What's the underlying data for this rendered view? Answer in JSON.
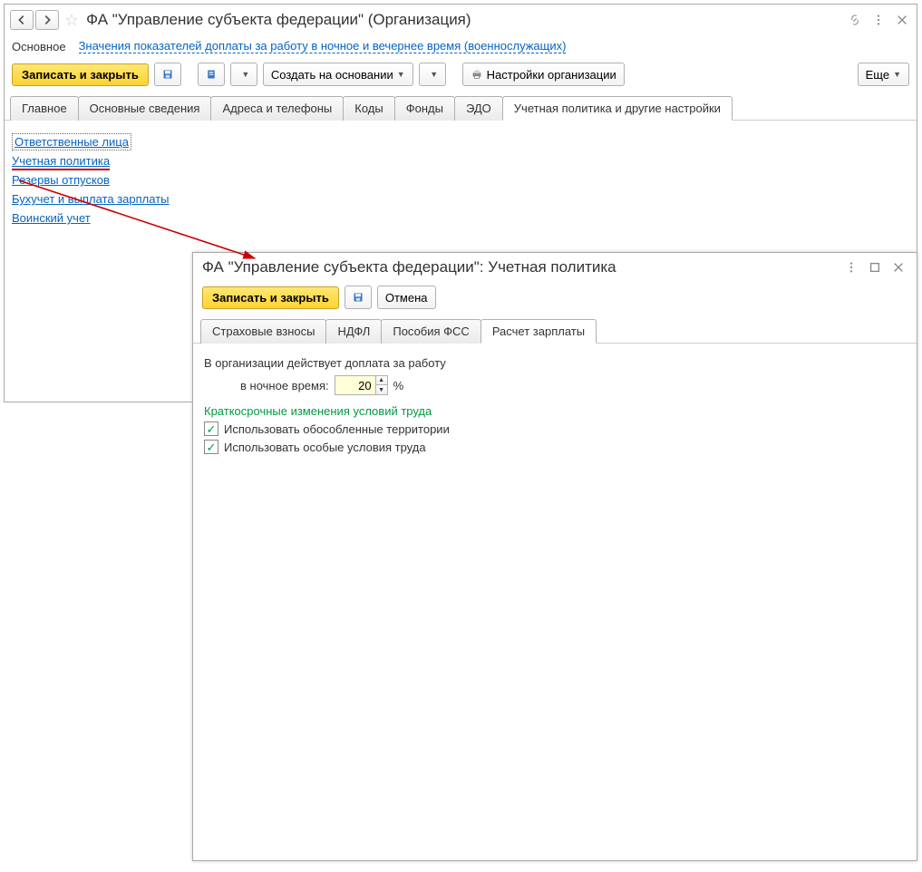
{
  "main": {
    "title": "ФА \"Управление субъекта федерации\" (Организация)",
    "menu": {
      "main_label": "Основное",
      "link_label": "Значения показателей доплаты за работу в ночное и вечернее время (военнослужащих)"
    },
    "toolbar": {
      "save_close": "Записать и закрыть",
      "create_based": "Создать на основании",
      "org_settings": "Настройки организации",
      "more": "Еще"
    },
    "tabs": [
      "Главное",
      "Основные сведения",
      "Адреса и телефоны",
      "Коды",
      "Фонды",
      "ЭДО",
      "Учетная политика и другие настройки"
    ],
    "active_tab_index": 6,
    "links": [
      "Ответственные лица",
      "Учетная политика",
      "Резервы отпусков",
      "Бухучет и выплата зарплаты",
      "Воинский учет"
    ]
  },
  "dialog": {
    "title": "ФА \"Управление субъекта федерации\": Учетная политика",
    "toolbar": {
      "save_close": "Записать и закрыть",
      "cancel": "Отмена"
    },
    "tabs": [
      "Страховые взносы",
      "НДФЛ",
      "Пособия ФСС",
      "Расчет зарплаты"
    ],
    "active_tab_index": 3,
    "body": {
      "intro": "В организации действует доплата за работу",
      "night_label": "в ночное время:",
      "night_value": "20",
      "percent": "%",
      "section": "Краткосрочные изменения условий труда",
      "chk1_label": "Использовать обособленные территории",
      "chk1_checked": true,
      "chk2_label": "Использовать особые условия труда",
      "chk2_checked": true
    }
  }
}
